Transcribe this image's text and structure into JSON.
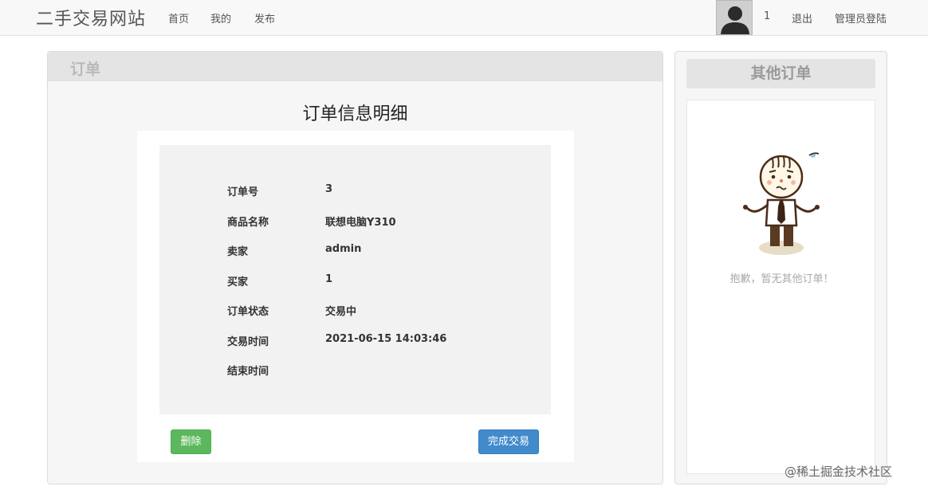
{
  "navbar": {
    "brand": "二手交易网站",
    "links": [
      "首页",
      "我的",
      "发布"
    ],
    "user_id": "1",
    "logout": "退出",
    "admin_login": "管理员登陆"
  },
  "order_panel": {
    "title": "订单",
    "detail_title": "订单信息明细",
    "rows": [
      {
        "label": "订单号",
        "value": "3"
      },
      {
        "label": "商品名称",
        "value": "联想电脑Y310"
      },
      {
        "label": "卖家",
        "value": "admin"
      },
      {
        "label": "买家",
        "value": "1"
      },
      {
        "label": "订单状态",
        "value": "交易中"
      },
      {
        "label": "交易时间",
        "value": "2021-06-15 14:03:46"
      },
      {
        "label": "结束时间",
        "value": ""
      }
    ],
    "delete_label": "删除",
    "complete_label": "完成交易"
  },
  "other_orders": {
    "title": "其他订单",
    "empty_message": "抱歉，暂无其他订单！"
  },
  "watermark": "@稀土掘金技术社区",
  "icons": {
    "avatar": "user-avatar-icon",
    "mascot": "sorry-mascot-icon"
  },
  "colors": {
    "delete_button": "#5cb85c",
    "complete_button": "#428bca"
  }
}
